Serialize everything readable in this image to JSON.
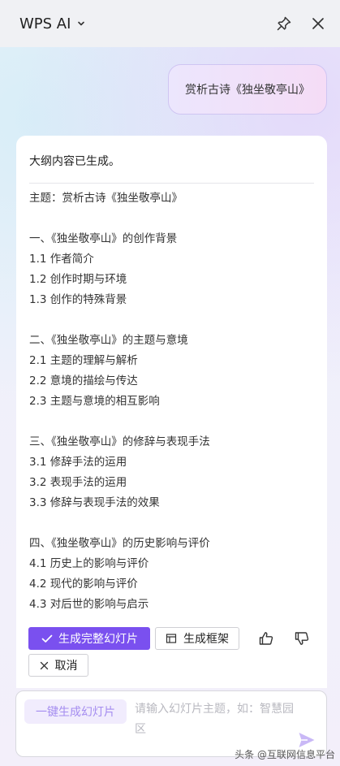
{
  "titlebar": {
    "app_name": "WPS AI",
    "icons": {
      "dropdown": "chevron-down-icon",
      "pin": "pin-icon",
      "close": "close-icon"
    }
  },
  "user_message": "赏析古诗《独坐敬亭山》",
  "answer": {
    "status": "大纲内容已生成。",
    "outline": [
      "主题：赏析古诗《独坐敬亭山》",
      "",
      "一、《独坐敬亭山》的创作背景",
      "1.1 作者简介",
      "1.2 创作时期与环境",
      "1.3 创作的特殊背景",
      "",
      "二、《独坐敬亭山》的主题与意境",
      "2.1 主题的理解与解析",
      "2.2 意境的描绘与传达",
      "2.3 主题与意境的相互影响",
      "",
      "三、《独坐敬亭山》的修辞与表现手法",
      "3.1 修辞手法的运用",
      "3.2 表现手法的运用",
      "3.3 修辞与表现手法的效果",
      "",
      "四、《独坐敬亭山》的历史影响与评价",
      "4.1 历史上的影响与评价",
      "4.2 现代的影响与评价",
      "4.3 对后世的影响与启示"
    ],
    "actions": {
      "generate_full": "生成完整幻灯片",
      "generate_frame": "生成框架",
      "cancel": "取消"
    }
  },
  "composer": {
    "quick_button": "一键生成幻灯片",
    "placeholder": "请输入幻灯片主题，如：智慧园区"
  },
  "watermark": "头条 @互联网信息平台",
  "colors": {
    "accent": "#7a50ef",
    "user_bubble": "#efe3fb"
  }
}
